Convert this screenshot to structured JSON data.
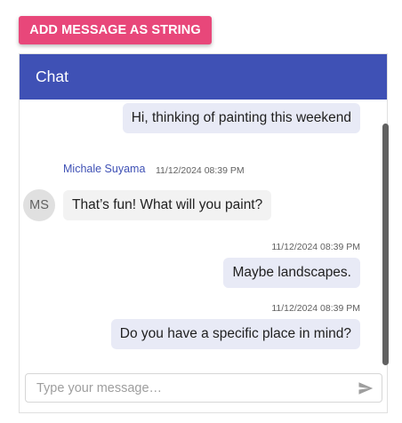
{
  "toolbar": {
    "add_button_label": "ADD MESSAGE AS STRING"
  },
  "chat": {
    "header_title": "Chat",
    "messages": [
      {
        "text": "Hi, thinking of painting this weekend",
        "direction": "outgoing"
      },
      {
        "sender": "Michale Suyama",
        "timestamp": "11/12/2024 08:39 PM",
        "avatar_initials": "MS",
        "text": "That’s fun! What will you paint?",
        "direction": "incoming"
      },
      {
        "timestamp": "11/12/2024 08:39 PM",
        "text": "Maybe landscapes.",
        "direction": "outgoing"
      },
      {
        "timestamp": "11/12/2024 08:39 PM",
        "text": "Do you have a specific place in mind?",
        "direction": "outgoing"
      }
    ],
    "input": {
      "placeholder": "Type your message…",
      "value": ""
    },
    "send_icon": "send-icon"
  },
  "colors": {
    "button_bg": "#e8477a",
    "header_bg": "#3f51b5",
    "sender_name": "#3f51b5",
    "outgoing_bubble": "#e8eaf6",
    "incoming_bubble": "#f2f2f2"
  }
}
